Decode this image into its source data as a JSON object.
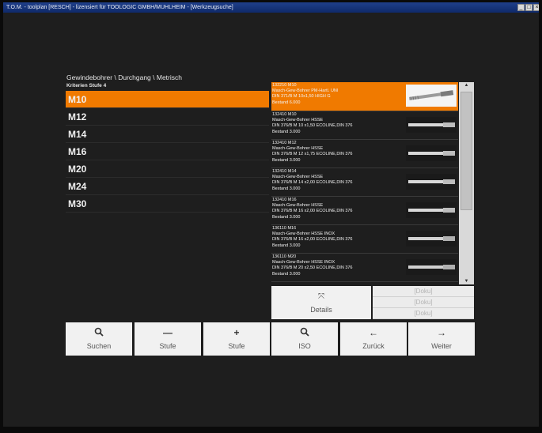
{
  "window": {
    "title": "T.O.M. - toolplan [RESCH] - lizensiert für TOOLOGIC GMBH/MUHLHEIM - [Werkzeugsuche]",
    "controls": [
      "_",
      "□",
      "×"
    ]
  },
  "breadcrumb": "Gewindebohrer \\ Durchgang \\ Metrisch",
  "criteria_label": "Kriterien Stufe 4",
  "sizes": [
    {
      "label": "M10",
      "selected": true
    },
    {
      "label": "M12",
      "selected": false
    },
    {
      "label": "M14",
      "selected": false
    },
    {
      "label": "M16",
      "selected": false
    },
    {
      "label": "M20",
      "selected": false
    },
    {
      "label": "M24",
      "selected": false
    },
    {
      "label": "M30",
      "selected": false
    }
  ],
  "results": [
    {
      "code": "132210 M10",
      "name": "Masch-Gew-Bohrer PM-Hartl. UNI",
      "spec": "DIN 371/B M 10x1,50     HIGH G",
      "stock": "Bestand 6.000",
      "selected": true
    },
    {
      "code": "132410 M10",
      "name": "Masch-Gew-Bohrer HSSE",
      "spec": "DIN 376/B M 10 x1,50     ECOLINE,DIN 376",
      "stock": "Bestand 3.000",
      "selected": false
    },
    {
      "code": "132410 M12",
      "name": "Masch-Gew-Bohrer HSSE",
      "spec": "DIN 376/B M 12 x1,75     ECOLINE,DIN 376",
      "stock": "Bestand 3.000",
      "selected": false
    },
    {
      "code": "132410 M14",
      "name": "Masch-Gew-Bohrer HSSE",
      "spec": "DIN 376/B M 14 x2,00     ECOLINE,DIN 376",
      "stock": "Bestand 3.000",
      "selected": false
    },
    {
      "code": "132410 M16",
      "name": "Masch-Gew-Bohrer HSSE",
      "spec": "DIN 376/B M 16 x2,00     ECOLINE,DIN 376",
      "stock": "Bestand 3.000",
      "selected": false
    },
    {
      "code": "136110 M16",
      "name": "Masch-Gew-Bohrer HSSE INOX",
      "spec": "DIN 376/B M 16 x2,00     ECOLINE,DIN 376",
      "stock": "Bestand 3.000",
      "selected": false
    },
    {
      "code": "136110 M20",
      "name": "Masch-Gew-Bohrer HSSE INOX",
      "spec": "DIN 376/B M 20 x2,50     ECOLINE,DIN 376",
      "stock": "Bestand 3.000",
      "selected": false
    }
  ],
  "details_button": {
    "label": "Details",
    "icon": "expand-icon"
  },
  "doku_items": [
    "[Doku]",
    "[Doku]",
    "[Doku]"
  ],
  "toolbar": [
    {
      "label": "Suchen",
      "icon": "search-icon",
      "glyph": "🔍"
    },
    {
      "label": "Stufe",
      "icon": "minus-icon",
      "glyph": "—"
    },
    {
      "label": "Stufe",
      "icon": "plus-icon",
      "glyph": "+"
    },
    {
      "label": "ISO",
      "icon": "search-icon",
      "glyph": "🔍"
    },
    {
      "label": "Zurück",
      "icon": "arrow-left-icon",
      "glyph": "←"
    },
    {
      "label": "Weiter",
      "icon": "arrow-right-icon",
      "glyph": "→"
    }
  ],
  "colors": {
    "accent": "#f07a00",
    "background": "#1e1e1e",
    "button": "#f1f1f1"
  }
}
